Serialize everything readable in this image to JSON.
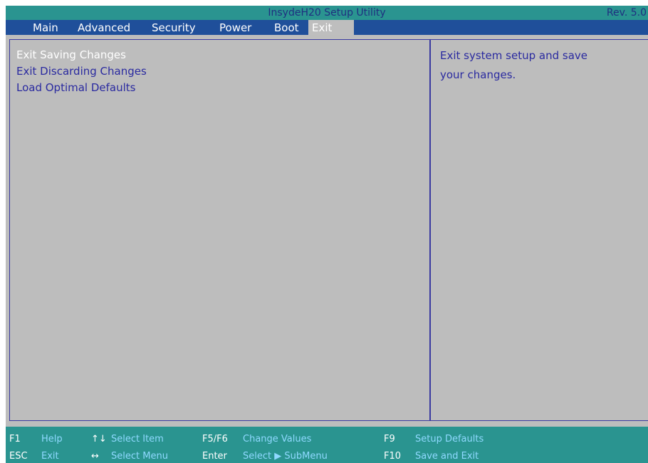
{
  "titlebar": {
    "title": "InsydeH20 Setup Utility",
    "rev": "Rev. 5.0"
  },
  "menu": {
    "tabs": [
      {
        "label": "Main"
      },
      {
        "label": "Advanced"
      },
      {
        "label": "Security"
      },
      {
        "label": "Power"
      },
      {
        "label": "Boot"
      },
      {
        "label": "Exit"
      }
    ],
    "active": "Exit"
  },
  "exit_menu": {
    "items": [
      {
        "label": "Exit Saving Changes",
        "selected": true
      },
      {
        "label": "Exit Discarding Changes"
      },
      {
        "label": "Load Optimal Defaults"
      }
    ]
  },
  "help": {
    "lines": [
      "Exit system setup and save",
      "your changes."
    ]
  },
  "footer": {
    "row1": [
      {
        "key": "F1",
        "desc": "Help"
      },
      {
        "key": "↑↓",
        "desc": "Select Item"
      },
      {
        "key": "F5/F6",
        "desc": "Change Values"
      },
      {
        "key": "F9",
        "desc": "Setup Defaults"
      }
    ],
    "row2": [
      {
        "key": "ESC",
        "desc": "Exit"
      },
      {
        "key": "↔",
        "desc": "Select Menu"
      },
      {
        "key": "Enter",
        "desc": "Select ▶ SubMenu"
      },
      {
        "key": "F10",
        "desc": "Save and Exit"
      }
    ]
  },
  "colors": {
    "title_bar": "#2a9490",
    "menu_bar": "#1f4f9a",
    "panel_bg": "#bdbdbd",
    "item_text": "#2a2aa0",
    "selected_text": "#ffffff",
    "footer_key": "#ffffff",
    "footer_desc": "#8fd9ff"
  }
}
